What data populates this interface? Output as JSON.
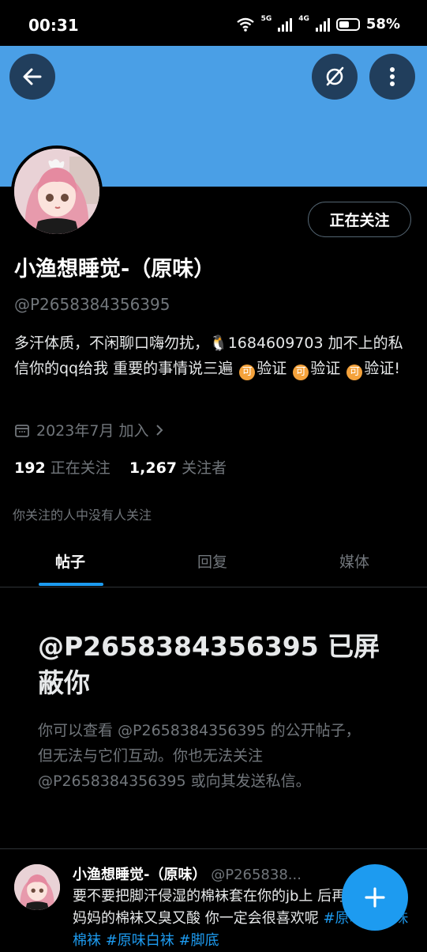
{
  "status_bar": {
    "time": "00:31",
    "net1": "5G",
    "net2": "4G",
    "battery": "58%"
  },
  "profile": {
    "follow_button": "正在关注",
    "name": "小渔想睡觉-（原味）",
    "handle": "@P2658384356395",
    "bio_part1": "多汗体质，不闲聊口嗨勿扰，",
    "bio_qq_emoji": "🐧",
    "bio_part2": "1684609703 加不上的私信你的qq给我 重要的事情说三遍",
    "coin_emoji": "可",
    "bio_verify": "验证",
    "bio_verify_last": "验证!",
    "joined": "2023年7月 加入",
    "following_count": "192",
    "following_label": "正在关注",
    "followers_count": "1,267",
    "followers_label": "关注者",
    "mutuals": "你关注的人中没有人关注"
  },
  "tabs": [
    {
      "label": "帖子",
      "active": true
    },
    {
      "label": "回复",
      "active": false
    },
    {
      "label": "媒体",
      "active": false
    }
  ],
  "blocked": {
    "title": "@P2658384356395 已屏蔽你",
    "text": "你可以查看 @P2658384356395 的公开帖子，但无法与它们互动。你也无法关注 @P2658384356395 或向其发送私信。"
  },
  "post": {
    "name": "小渔想睡觉-（原味）",
    "handle": "@P265838...",
    "text": "要不要把脚汗侵湿的棉袜套在你的jb上 后再塞你嘴里 妈妈的棉袜又臭又酸 你一定会很喜欢呢",
    "tags": "#原味 #原味棉袜 #原味白袜 #脚底"
  },
  "colors": {
    "banner": "#4a9fe6",
    "accent": "#1d9bf0",
    "muted": "#71767b"
  }
}
